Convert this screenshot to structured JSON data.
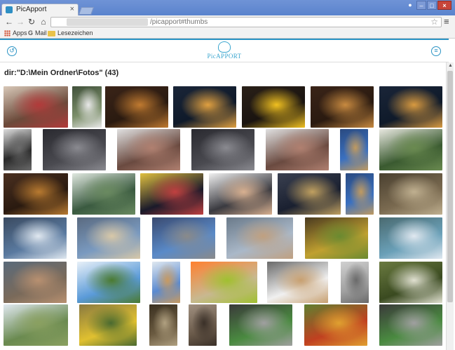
{
  "browser": {
    "tab_title": "PicApport",
    "url_path": "/picapport#thumbs",
    "bookmarks": {
      "apps": "Apps",
      "mail": "Mail",
      "lesezeichen": "Lesezeichen"
    }
  },
  "app": {
    "logo_text": "PicAPPORT",
    "dir_title": "dir:\"D:\\Mein Ordner\\Fotos\" (43)"
  },
  "thumbnails": [
    {
      "subject": "market-produce",
      "colors": [
        "#6b4a3a",
        "#b23a3a",
        "#d8c8b8"
      ]
    },
    {
      "subject": "pagoda",
      "colors": [
        "#7c8f6a",
        "#e8e8e8",
        "#40503a"
      ]
    },
    {
      "subject": "tunnel",
      "colors": [
        "#2a1a10",
        "#c07a30",
        "#3a2418"
      ]
    },
    {
      "subject": "night-harbor",
      "colors": [
        "#0f1a2a",
        "#e0a040",
        "#1a2538"
      ]
    },
    {
      "subject": "yellow-taxi",
      "colors": [
        "#1a1410",
        "#f0c020",
        "#2a2018"
      ]
    },
    {
      "subject": "tunnel",
      "colors": [
        "#2a1a10",
        "#c88a40",
        "#3a2418"
      ]
    },
    {
      "subject": "night-harbor",
      "colors": [
        "#0f1a2a",
        "#d89a40",
        "#1a2538"
      ]
    },
    {
      "subject": "street-night",
      "colors": [
        "#2a2a2a",
        "#6a6a6a",
        "#dcdcdc"
      ]
    },
    {
      "subject": "subway-train",
      "colors": [
        "#4a4a50",
        "#8a8a90",
        "#2a2a30"
      ]
    },
    {
      "subject": "city-buildings",
      "colors": [
        "#6a4a40",
        "#b08070",
        "#e0e0e0"
      ]
    },
    {
      "subject": "subway-train",
      "colors": [
        "#4a4a50",
        "#8a8a90",
        "#2a2a30"
      ]
    },
    {
      "subject": "city-buildings",
      "colors": [
        "#6a4a40",
        "#b08070",
        "#e0e0e0"
      ]
    },
    {
      "subject": "big-ben",
      "colors": [
        "#3a70c0",
        "#c09a60",
        "#2a4a80"
      ]
    },
    {
      "subject": "garden",
      "colors": [
        "#3a5a30",
        "#6a8a50",
        "#e8e8e0"
      ]
    },
    {
      "subject": "autumn-tree-night",
      "colors": [
        "#2a1a10",
        "#b87a30",
        "#4a3020"
      ]
    },
    {
      "subject": "pond-garden",
      "colors": [
        "#3a5a40",
        "#6a8a60",
        "#e0e8e0"
      ]
    },
    {
      "subject": "times-square",
      "colors": [
        "#1a1a2a",
        "#c04040",
        "#e0c040"
      ]
    },
    {
      "subject": "people-child",
      "colors": [
        "#3a3a40",
        "#d8b090",
        "#f0f0f0"
      ]
    },
    {
      "subject": "city-night",
      "colors": [
        "#1a2030",
        "#c0a060",
        "#3a4050"
      ]
    },
    {
      "subject": "big-ben",
      "colors": [
        "#3a70c0",
        "#c09a60",
        "#2a4a80"
      ]
    },
    {
      "subject": "metro-station",
      "colors": [
        "#7a6a50",
        "#c0b090",
        "#4a4030"
      ]
    },
    {
      "subject": "bridge",
      "colors": [
        "#5a7aa0",
        "#e0e8f0",
        "#3a4a60"
      ]
    },
    {
      "subject": "mosque",
      "colors": [
        "#7a9ac0",
        "#d8c8a8",
        "#5a6a80"
      ]
    },
    {
      "subject": "blue-mosque",
      "colors": [
        "#5a8ac8",
        "#8a8a8a",
        "#3a4a70"
      ]
    },
    {
      "subject": "galata-city",
      "colors": [
        "#aab8c8",
        "#c0a080",
        "#6a7a8a"
      ]
    },
    {
      "subject": "fruit-stand",
      "colors": [
        "#c0a030",
        "#6a8a30",
        "#4a3a20"
      ]
    },
    {
      "subject": "sea-coast",
      "colors": [
        "#6aa0b8",
        "#e0e8f0",
        "#4a6a70"
      ]
    },
    {
      "subject": "city-panorama",
      "colors": [
        "#7a6a5a",
        "#b89070",
        "#5a6a7a"
      ]
    },
    {
      "subject": "tree-sky",
      "colors": [
        "#5a9ad8",
        "#4a7a30",
        "#e8f0f8"
      ]
    },
    {
      "subject": "dog-sky",
      "colors": [
        "#5a8ad0",
        "#c89a60",
        "#e0e8f0"
      ]
    },
    {
      "subject": "parrot-circle",
      "colors": [
        "#c8b890",
        "#a0c030",
        "#ff8030"
      ]
    },
    {
      "subject": "dog-white",
      "colors": [
        "#f0f0f0",
        "#c8a070",
        "#6a6a6a"
      ]
    },
    {
      "subject": "dog-floor",
      "colors": [
        "#a0a0a0",
        "#6a6a6a",
        "#d0d0d0"
      ]
    },
    {
      "subject": "flowers-bush",
      "colors": [
        "#3a4a20",
        "#e0e0d0",
        "#6a7a40"
      ]
    },
    {
      "subject": "cactus-field",
      "colors": [
        "#6a8a50",
        "#8aa060",
        "#e0e8f0"
      ]
    },
    {
      "subject": "yellow-car",
      "colors": [
        "#e0c030",
        "#4a6a30",
        "#8a7a40"
      ]
    },
    {
      "subject": "bird-statue",
      "colors": [
        "#6a5a40",
        "#b0a080",
        "#3a3020"
      ]
    },
    {
      "subject": "donkey",
      "colors": [
        "#6a5a4a",
        "#3a3028",
        "#a09080"
      ]
    },
    {
      "subject": "train-people",
      "colors": [
        "#4a8a40",
        "#a0a0a0",
        "#3a3a3a"
      ]
    },
    {
      "subject": "fruits-melon",
      "colors": [
        "#c04020",
        "#e0a030",
        "#608030"
      ]
    },
    {
      "subject": "train-people",
      "colors": [
        "#4a8a40",
        "#a0a0a0",
        "#3a3a3a"
      ]
    }
  ]
}
